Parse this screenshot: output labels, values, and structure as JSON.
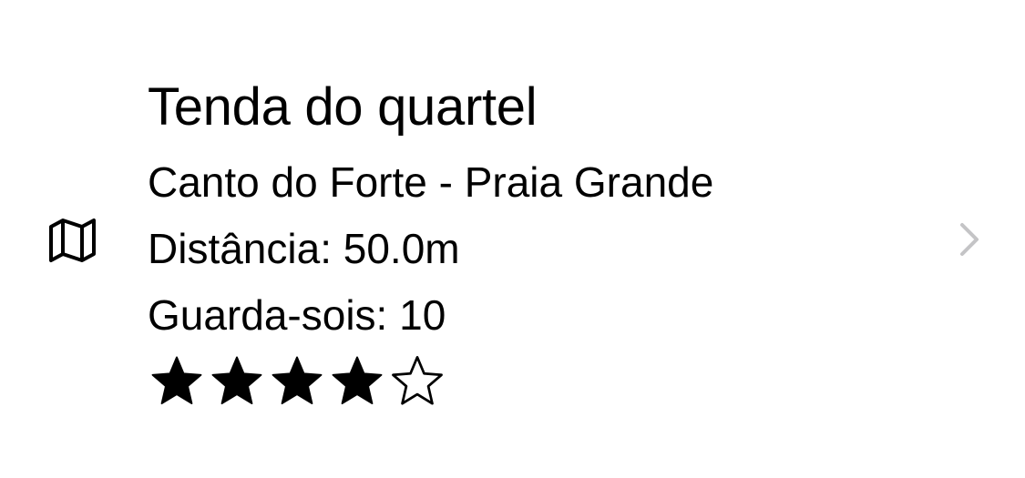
{
  "row": {
    "icon": "map-icon",
    "title": "Tenda do quartel",
    "address": "Canto do Forte - Praia Grande",
    "distance": "Distância: 50.0m",
    "umbrellas": "Guarda-sois: 10",
    "rating": 4,
    "rating_max": 5,
    "accessory": "chevron-right-icon"
  },
  "colors": {
    "text": "#000000",
    "chevron": "#c4c4c6",
    "background": "#ffffff"
  }
}
